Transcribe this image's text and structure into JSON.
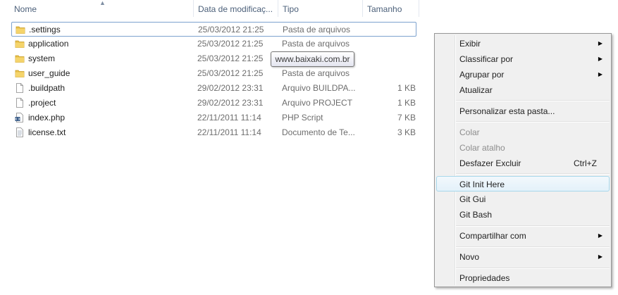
{
  "columns": {
    "name": "Nome",
    "date": "Data de modificaç...",
    "type": "Tipo",
    "size": "Tamanho"
  },
  "files": [
    {
      "name": ".settings",
      "date": "25/03/2012 21:25",
      "type": "Pasta de arquivos",
      "size": "",
      "icon": "folder-icon"
    },
    {
      "name": "application",
      "date": "25/03/2012 21:25",
      "type": "Pasta de arquivos",
      "size": "",
      "icon": "folder-icon"
    },
    {
      "name": "system",
      "date": "25/03/2012 21:25",
      "type": "",
      "size": "",
      "icon": "folder-icon"
    },
    {
      "name": "user_guide",
      "date": "25/03/2012 21:25",
      "type": "Pasta de arquivos",
      "size": "",
      "icon": "folder-icon"
    },
    {
      "name": ".buildpath",
      "date": "29/02/2012 23:31",
      "type": "Arquivo BUILDPA...",
      "size": "1 KB",
      "icon": "file-icon"
    },
    {
      "name": ".project",
      "date": "29/02/2012 23:31",
      "type": "Arquivo PROJECT",
      "size": "1 KB",
      "icon": "file-icon"
    },
    {
      "name": "index.php",
      "date": "22/11/2011 11:14",
      "type": "PHP Script",
      "size": "7 KB",
      "icon": "php-file-icon"
    },
    {
      "name": "license.txt",
      "date": "22/11/2011 11:14",
      "type": "Documento de Te...",
      "size": "3 KB",
      "icon": "text-file-icon"
    }
  ],
  "tooltip": "www.baixaki.com.br",
  "context_menu": {
    "items": [
      {
        "label": "Exibir",
        "submenu": true
      },
      {
        "label": "Classificar por",
        "submenu": true
      },
      {
        "label": "Agrupar por",
        "submenu": true
      },
      {
        "label": "Atualizar"
      },
      {
        "label": "Personalizar esta pasta..."
      },
      {
        "label": "Colar",
        "disabled": true
      },
      {
        "label": "Colar atalho",
        "disabled": true
      },
      {
        "label": "Desfazer Excluir",
        "shortcut": "Ctrl+Z"
      },
      {
        "label": "Git Init Here",
        "highlighted": true
      },
      {
        "label": "Git Gui"
      },
      {
        "label": "Git Bash"
      },
      {
        "label": "Compartilhar com",
        "submenu": true
      },
      {
        "label": "Novo",
        "submenu": true
      },
      {
        "label": "Propriedades"
      }
    ]
  },
  "colors": {
    "folder": "#e8c04a",
    "selection_border": "#7da2ce",
    "menu_highlight_border": "#a8d8eb",
    "header_text": "#4c607a"
  }
}
